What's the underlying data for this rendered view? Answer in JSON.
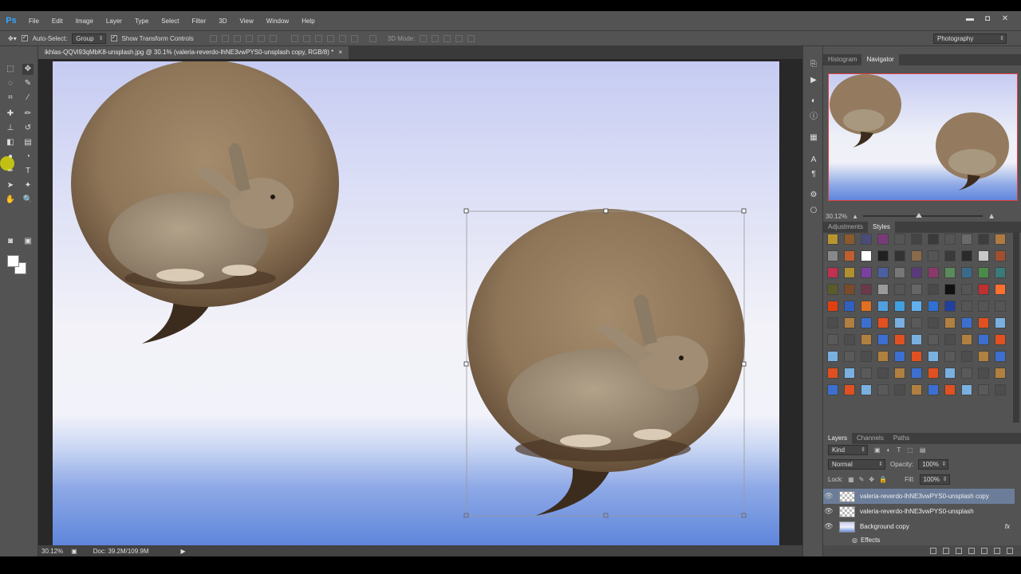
{
  "app": {
    "logo": "Ps"
  },
  "menu": [
    "File",
    "Edit",
    "Image",
    "Layer",
    "Type",
    "Select",
    "Filter",
    "3D",
    "View",
    "Window",
    "Help"
  ],
  "window_controls": {
    "minimize": "▬",
    "restore": "◘",
    "close": "✕"
  },
  "options_bar": {
    "auto_select_label": "Auto-Select:",
    "auto_select_value": "Group",
    "show_transform_label": "Show Transform Controls",
    "mode_3d_label": "3D Mode:",
    "workspace": "Photography"
  },
  "document_tab": {
    "title": "ikhlas-QQVi93qMbK8-unsplash.jpg @ 30.1% (valeria-reverdo-lhNE3vwPYS0-unsplash copy, RGB/8) *",
    "close": "×"
  },
  "status_bar": {
    "zoom": "30.12%",
    "doc": "Doc: 39.2M/109.9M"
  },
  "navigator": {
    "tabs": [
      "Histogram",
      "Navigator"
    ],
    "active_tab": "Navigator",
    "zoom": "30.12%",
    "zoom_fraction": 0.44
  },
  "styles_panel": {
    "tabs": [
      "Adjustments",
      "Styles"
    ],
    "active_tab": "Styles"
  },
  "layers_panel": {
    "tabs": [
      "Layers",
      "Channels",
      "Paths"
    ],
    "active_tab": "Layers",
    "filter_kind": "Kind",
    "blend_mode": "Normal",
    "opacity_label": "Opacity:",
    "opacity": "100%",
    "lock_label": "Lock:",
    "fill_label": "Fill:",
    "fill": "100%",
    "layers": [
      {
        "name": "valeria-reverdo-lhNE3vwPYS0-unsplash copy",
        "selected": true
      },
      {
        "name": "valeria-reverdo-lhNE3vwPYS0-unsplash",
        "selected": false
      },
      {
        "name": "Background copy",
        "selected": false,
        "fx": "fx"
      }
    ],
    "effects_label": "Effects"
  },
  "colors": {
    "ui_dark": "#535353",
    "accent_selection": "#6b7d99",
    "ps_blue": "#31a8ff"
  }
}
